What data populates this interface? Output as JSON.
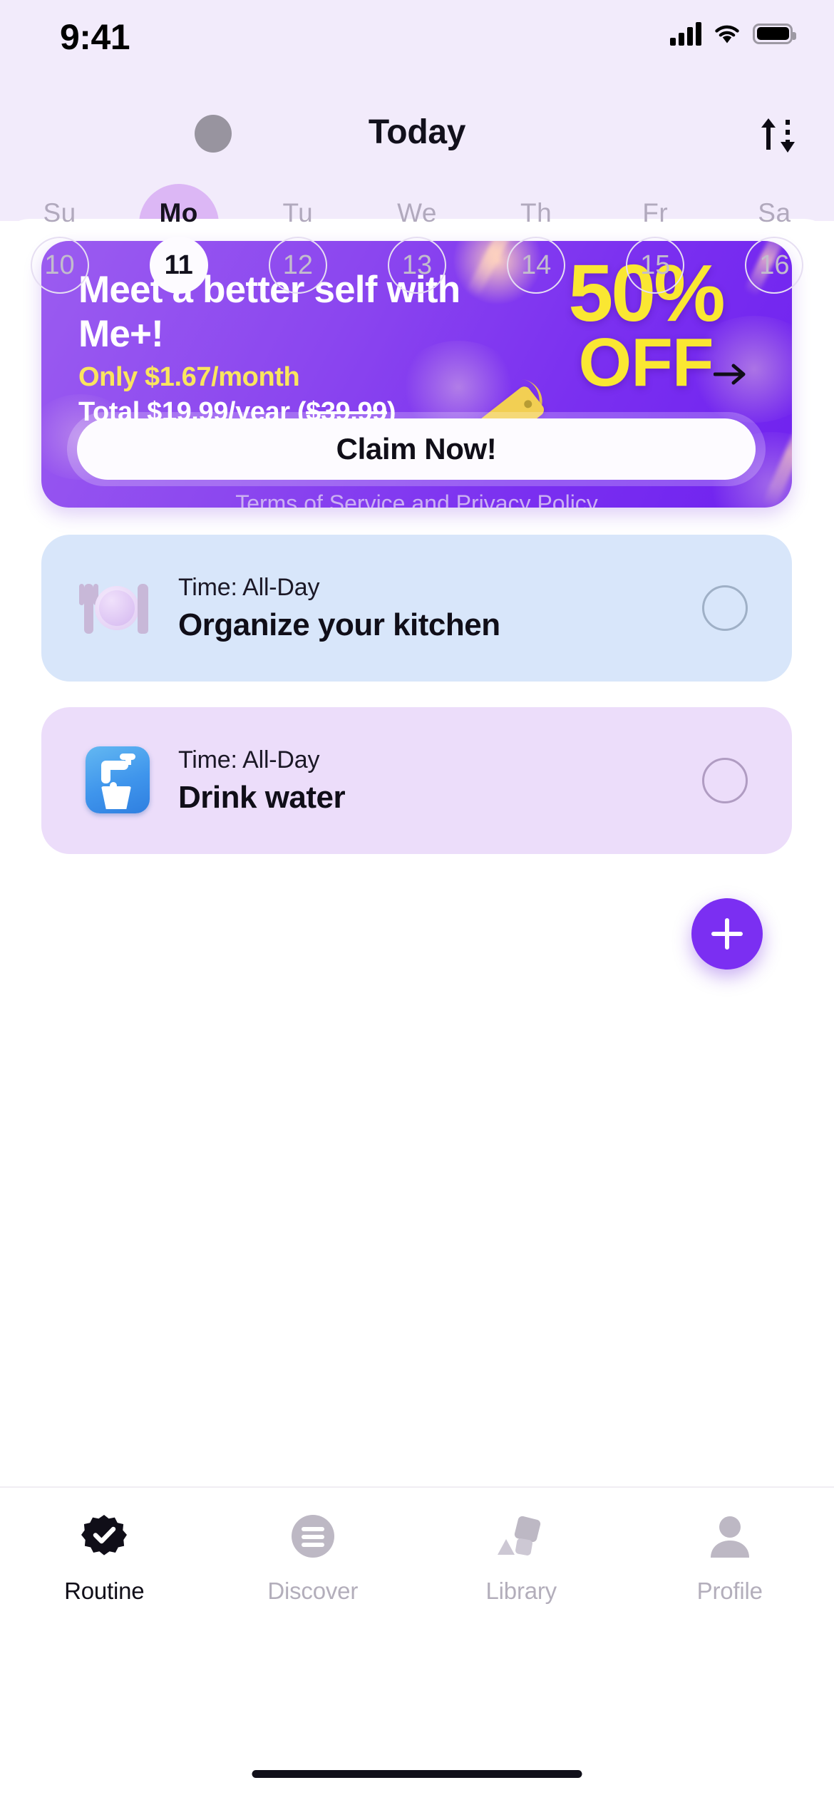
{
  "status_bar": {
    "time": "9:41",
    "signal_icon": "cellular-signal-icon",
    "wifi_icon": "wifi-icon",
    "battery_icon": "battery-icon"
  },
  "nav": {
    "title": "Today",
    "avatar_name": "user-avatar",
    "sort_icon": "sort-arrows-icon"
  },
  "week": {
    "days": [
      {
        "dow": "Su",
        "date": "10",
        "selected": false
      },
      {
        "dow": "Mo",
        "date": "11",
        "selected": true
      },
      {
        "dow": "Tu",
        "date": "12",
        "selected": false
      },
      {
        "dow": "We",
        "date": "13",
        "selected": false
      },
      {
        "dow": "Th",
        "date": "14",
        "selected": false
      },
      {
        "dow": "Fr",
        "date": "15",
        "selected": false
      },
      {
        "dow": "Sa",
        "date": "16",
        "selected": false
      }
    ]
  },
  "promo": {
    "headline": "Meet a better self with Me+!",
    "price_monthly": "Only $1.67/month",
    "price_total_prefix": "Total $19.99/year (",
    "price_total_struck": "$39.99",
    "price_total_suffix": ")",
    "badge_percent": "50%",
    "badge_off": "OFF",
    "cta_label": "Claim Now!",
    "cta_arrow_icon": "arrow-right-icon",
    "terms_label": "Terms of Service and Privacy Policy",
    "tag_icon": "price-tag-icon",
    "accent_yellow": "#fae732",
    "bg_purple": "#7a2ff0"
  },
  "tasks": [
    {
      "time": "Time: All-Day",
      "title": "Organize your kitchen",
      "icon": "plate-fork-knife-emoji",
      "bg": "#d8e6fa",
      "completed": false
    },
    {
      "time": "Time: All-Day",
      "title": "Drink water",
      "icon": "faucet-water-emoji",
      "bg": "#ecddfa",
      "completed": false
    }
  ],
  "fab": {
    "label": "+",
    "icon": "plus-icon",
    "color": "#7b2ff2"
  },
  "tabbar": {
    "items": [
      {
        "label": "Routine",
        "icon": "check-badge-icon",
        "active": true
      },
      {
        "label": "Discover",
        "icon": "lines-circle-icon",
        "active": false
      },
      {
        "label": "Library",
        "icon": "shapes-icon",
        "active": false
      },
      {
        "label": "Profile",
        "icon": "person-icon",
        "active": false
      }
    ]
  }
}
